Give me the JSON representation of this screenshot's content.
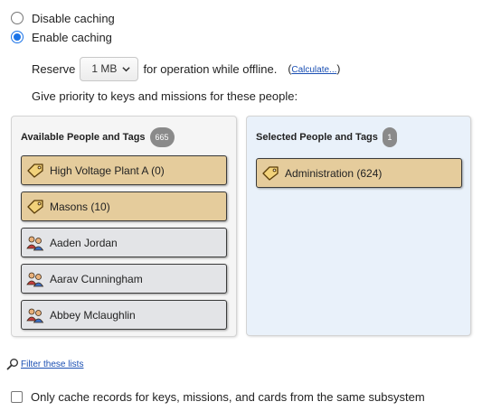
{
  "caching": {
    "disable_label": "Disable caching",
    "enable_label": "Enable caching",
    "selected": "enable"
  },
  "reserve": {
    "label": "Reserve",
    "value": "1 MB",
    "suffix": "for operation while offline.",
    "calculate_open": "(",
    "calculate_link": "Calculate...",
    "calculate_close": ")"
  },
  "priority_text": "Give priority to keys and missions for these people:",
  "available": {
    "title": "Available People and Tags",
    "count": "665",
    "items": [
      {
        "type": "tag",
        "label": "High Voltage Plant A (0)"
      },
      {
        "type": "tag",
        "label": "Masons (10)"
      },
      {
        "type": "person",
        "label": "Aaden Jordan"
      },
      {
        "type": "person",
        "label": "Aarav Cunningham"
      },
      {
        "type": "person",
        "label": "Abbey Mclaughlin"
      }
    ]
  },
  "selected": {
    "title": "Selected People and Tags",
    "count": "1",
    "items": [
      {
        "type": "tag",
        "label": "Administration (624)"
      }
    ]
  },
  "filter_link": "Filter these lists",
  "subsystem_checkbox": {
    "label": "Only cache records for keys, missions, and cards from the same subsystem",
    "checked": false
  },
  "colors": {
    "link": "#1a4fb3",
    "radio_accent": "#1a73e8",
    "tag_fill": "#e5cc9c",
    "person_fill": "#e3e4e7",
    "selected_panel": "#e9f1fa"
  },
  "icons": {
    "tag": "tag-icon",
    "person": "people-icon",
    "filter": "magnifier-icon"
  }
}
